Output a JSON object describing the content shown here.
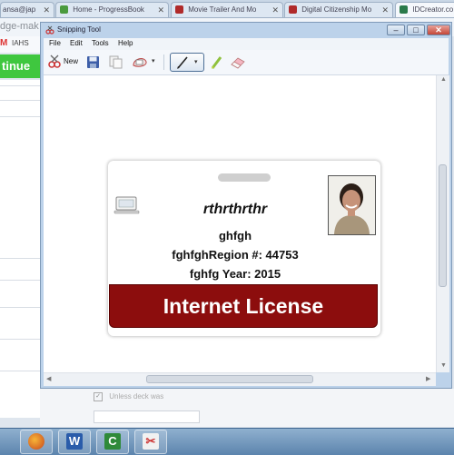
{
  "browser": {
    "tabs": [
      {
        "label": "ansa@jap",
        "favicon_color": "#f5f5f5"
      },
      {
        "label": "Home - ProgressBook",
        "favicon_color": "#4a9a3d"
      },
      {
        "label": "Movie Trailer And Mo",
        "favicon_color": "#b02a2a"
      },
      {
        "label": "Digital Citizenship Mo",
        "favicon_color": "#b02a2a"
      },
      {
        "label": "IDCreator.co",
        "favicon_color": "#2a7a4a"
      }
    ],
    "address_partial": "dge-mak",
    "bookmark_label": "IAHS",
    "continue_label": "tinue",
    "checkbox_label": "Unless deck was"
  },
  "snipping_tool": {
    "title": "Snipping Tool",
    "menu": [
      "File",
      "Edit",
      "Tools",
      "Help"
    ],
    "toolbar": {
      "new_label": "New",
      "icons": [
        "new-snip-icon",
        "save-icon",
        "copy-icon",
        "send-snip-icon",
        "pen-icon",
        "highlighter-icon",
        "eraser-icon"
      ]
    },
    "window_buttons": [
      "minimize",
      "maximize",
      "close"
    ]
  },
  "id_card": {
    "name": "rthrthrthr",
    "line1": "ghfgh",
    "line2": "fghfghRegion #: 44753",
    "line3": "fghfg Year: 2015",
    "banner": "Internet License",
    "banner_color": "#8c0d0d"
  },
  "taskbar": {
    "apps": [
      "firefox-icon",
      "word-icon",
      "camtasia-icon",
      "snipping-tool-icon"
    ]
  }
}
